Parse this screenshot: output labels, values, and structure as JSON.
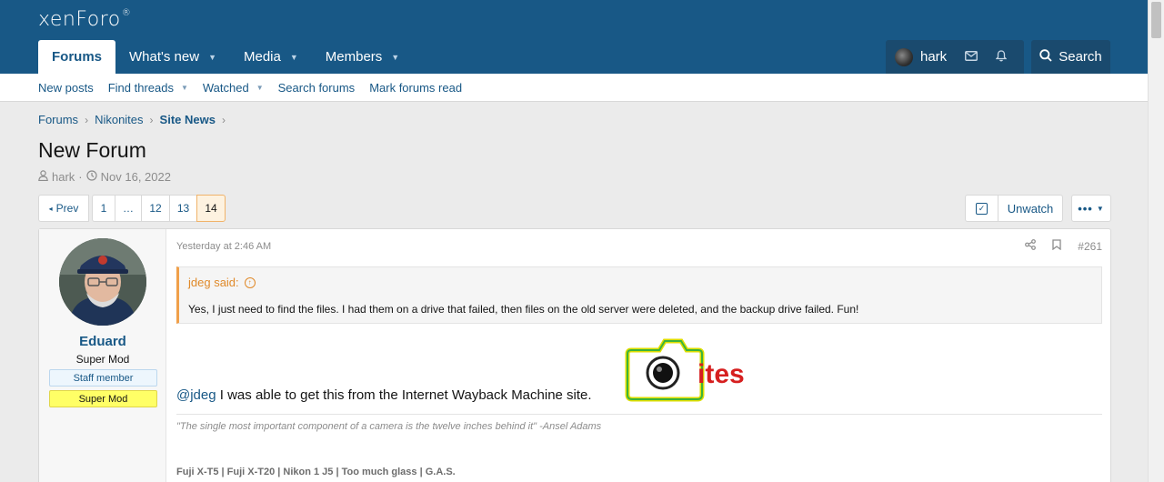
{
  "site": {
    "logo_text": "xenForo",
    "logo_mark": "®"
  },
  "nav": {
    "tabs": [
      {
        "label": "Forums"
      },
      {
        "label": "What's new"
      },
      {
        "label": "Media"
      },
      {
        "label": "Members"
      }
    ],
    "username": "hark",
    "search_label": "Search"
  },
  "subnav": {
    "items": [
      {
        "label": "New posts"
      },
      {
        "label": "Find threads"
      },
      {
        "label": "Watched"
      },
      {
        "label": "Search forums"
      },
      {
        "label": "Mark forums read"
      }
    ]
  },
  "breadcrumb": {
    "items": [
      "Forums",
      "Nikonites",
      "Site News"
    ]
  },
  "thread": {
    "title": "New Forum",
    "starter": "hark",
    "date": "Nov 16, 2022"
  },
  "pager": {
    "prev": "Prev",
    "pages": [
      "1",
      "…",
      "12",
      "13",
      "14"
    ],
    "current": "14"
  },
  "actions": {
    "unwatch": "Unwatch",
    "more": "•••"
  },
  "post": {
    "author": "Eduard",
    "user_title": "Super Mod",
    "banner_staff": "Staff member",
    "banner_mod": "Super Mod",
    "time": "Yesterday at 2:46 AM",
    "number": "#261",
    "quote_author": "jdeg said:",
    "quote_text": "Yes, I just need to find the files. I had them on a drive that failed, then files on the old server were deleted, and the backup drive failed. Fun!",
    "mention": "@jdeg",
    "body": " I was able to get this from the Internet Wayback Machine site.",
    "image_text": "ites",
    "signature_quote": "\"The single most important component of a camera is the twelve inches behind it\" -Ansel Adams",
    "signature_gear": "Fuji X-T5 | Fuji X-T20 | Nikon 1 J5 | Too much glass | G.A.S."
  },
  "colors": {
    "header": "#185886",
    "link": "#185886",
    "quote_accent": "#f0a04a",
    "mod_banner": "#ffff66"
  },
  "icons": [
    "user-icon",
    "clock-icon",
    "envelope-icon",
    "bell-icon",
    "search-icon",
    "share-icon",
    "bookmark-icon",
    "checkbox-icon"
  ]
}
